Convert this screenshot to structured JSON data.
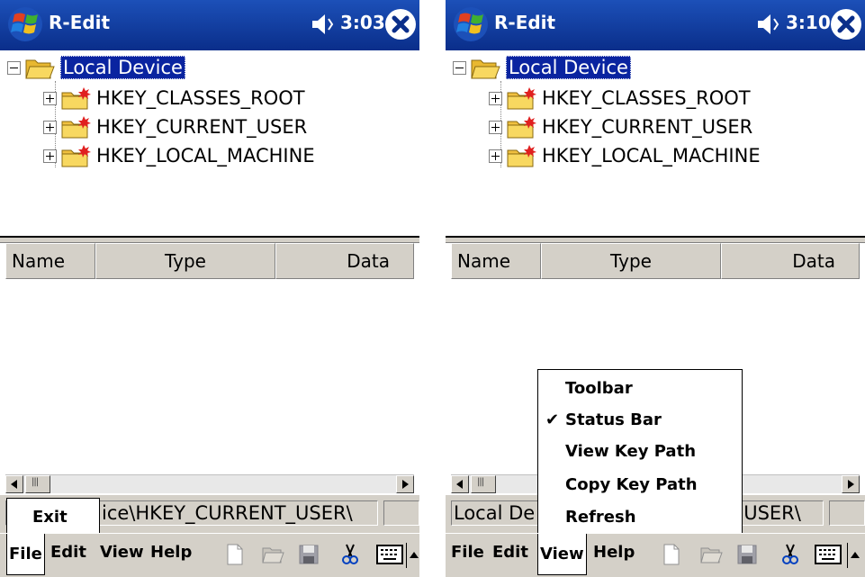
{
  "left_screen": {
    "app_title": "R-Edit",
    "clock": "3:03",
    "tree": {
      "root_label": "Local Device",
      "children": [
        "HKEY_CLASSES_ROOT",
        "HKEY_CURRENT_USER",
        "HKEY_LOCAL_MACHINE"
      ]
    },
    "list_columns": [
      "Name",
      "Type",
      "Data"
    ],
    "status_path": "ice\\HKEY_CURRENT_USER\\",
    "menu": {
      "file": "File",
      "edit": "Edit",
      "view": "View",
      "help": "Help"
    },
    "file_menu_items": [
      "Exit"
    ]
  },
  "right_screen": {
    "app_title": "R-Edit",
    "clock": "3:10",
    "tree": {
      "root_label": "Local Device",
      "children": [
        "HKEY_CLASSES_ROOT",
        "HKEY_CURRENT_USER",
        "HKEY_LOCAL_MACHINE"
      ]
    },
    "list_columns": [
      "Name",
      "Type",
      "Data"
    ],
    "status_path_left": "Local De",
    "status_path_right": "USER\\",
    "menu": {
      "file": "File",
      "edit": "Edit",
      "view": "View",
      "help": "Help"
    },
    "view_menu_items": [
      {
        "label": "Toolbar",
        "checked": false
      },
      {
        "label": "Status Bar",
        "checked": true
      },
      {
        "label": "View Key Path",
        "checked": false
      },
      {
        "label": "Copy Key Path",
        "checked": false
      },
      {
        "label": "Refresh",
        "checked": false
      }
    ],
    "check_mark": "✔"
  },
  "colors": {
    "title_bar": "#0a2e8a",
    "selection": "#0a24a0",
    "chrome": "#d4d0c8"
  },
  "icons": [
    "windows-start-icon",
    "speaker-icon",
    "close-icon",
    "folder-open-icon",
    "registry-folder-icon",
    "new-file-icon",
    "open-folder-icon",
    "save-icon",
    "cut-icon",
    "keyboard-icon"
  ]
}
